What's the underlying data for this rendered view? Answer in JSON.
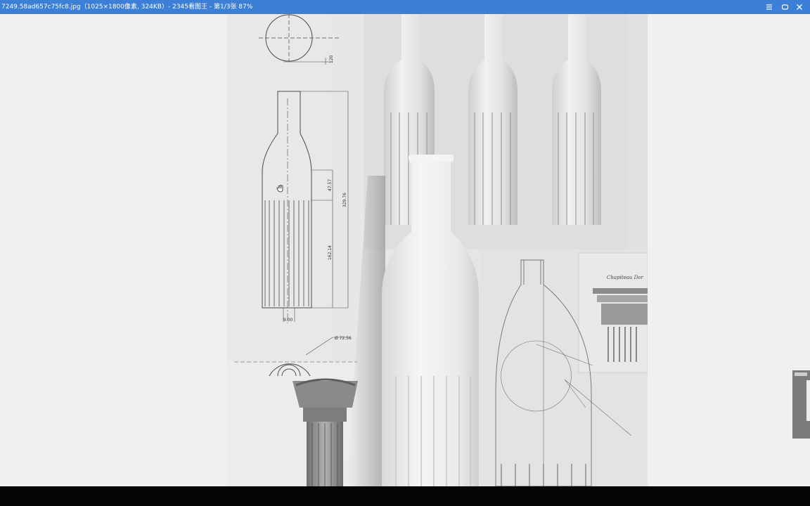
{
  "window": {
    "title": "7249.58ad657c75fc8.jpg（1025×1800像素, 324KB）- 2345看图王 - 第1/3张 87%",
    "menu_icon": "hamburger-menu-icon",
    "restore_icon": "window-restore-icon",
    "close_icon": "close-x-icon"
  },
  "image": {
    "drawing_labels": [
      "120",
      "47.57",
      "329.76",
      "162.14",
      "Ø 72.56",
      "9.00"
    ],
    "engraving_caption": "Chapiteau Dor"
  },
  "colors": {
    "titlebar": "#3c7fd6",
    "viewer_bg": "#f0f0f0",
    "bottom_bar": "#050505"
  }
}
